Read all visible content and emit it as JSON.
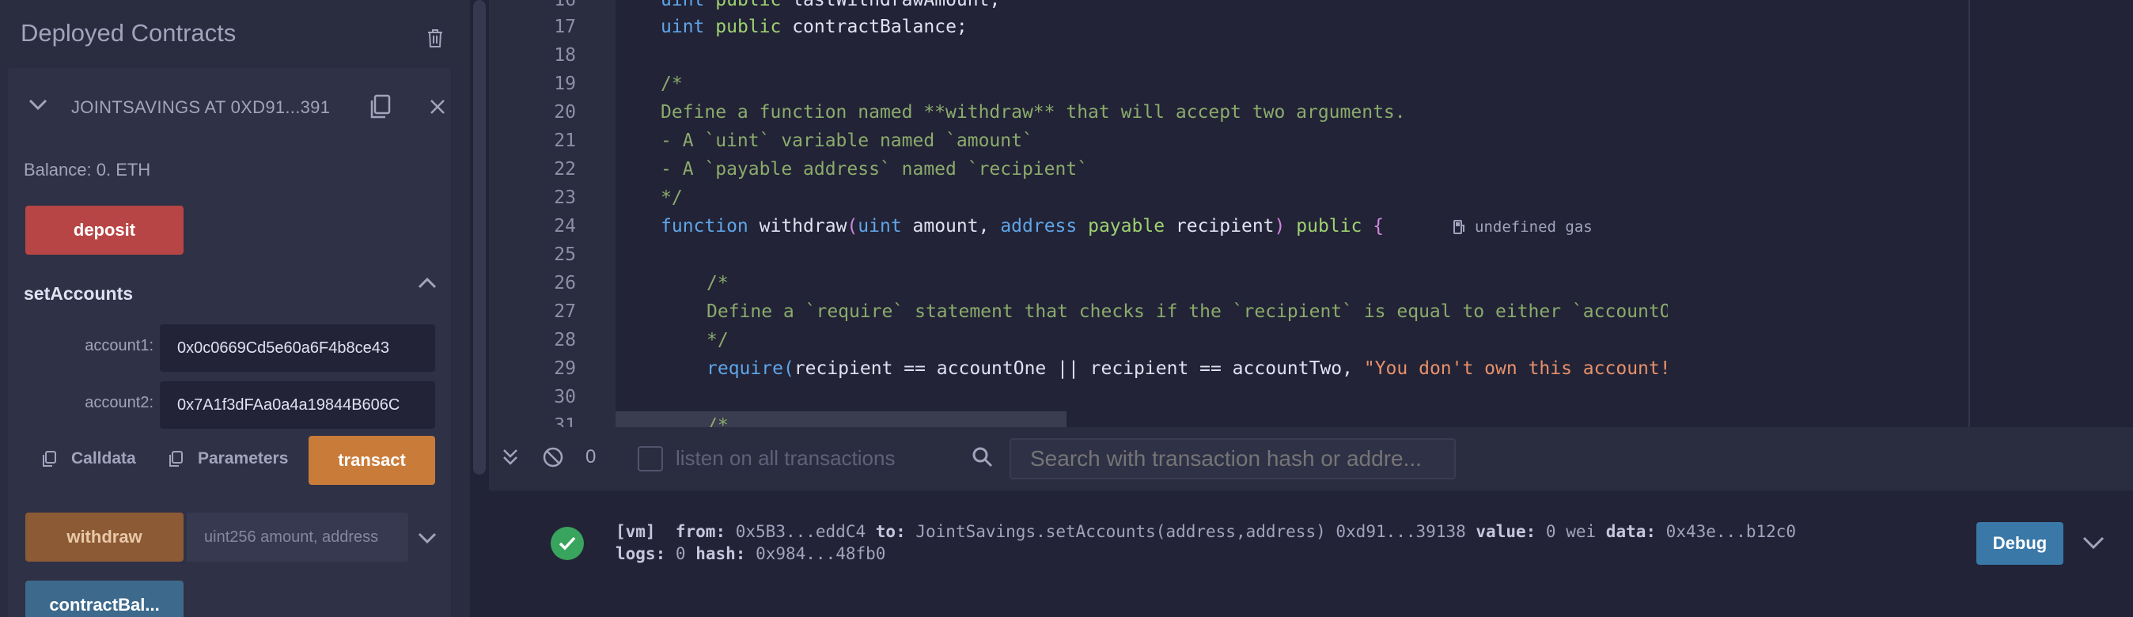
{
  "left_panel": {
    "title": "Deployed Contracts",
    "contract_name": "JOINTSAVINGS AT 0XD91...391",
    "balance": "Balance: 0. ETH",
    "deposit_label": "deposit",
    "set_accounts": {
      "title": "setAccounts",
      "account1_label": "account1:",
      "account1_value": "0x0c0669Cd5e60a6F4b8ce43",
      "account2_label": "account2:",
      "account2_value": "0x7A1f3dFAa0a4a19844B606C",
      "calldata_label": "Calldata",
      "parameters_label": "Parameters",
      "transact_label": "transact"
    },
    "withdraw_label": "withdraw",
    "withdraw_placeholder": "uint256 amount, address",
    "contract_balance_label": "contractBal..."
  },
  "editor": {
    "lines": [
      {
        "n": "16",
        "text": "uint public lastWithdrawAmount;"
      },
      {
        "n": "17",
        "text": "uint public contractBalance;"
      },
      {
        "n": "18",
        "text": ""
      },
      {
        "n": "19",
        "text": "/*"
      },
      {
        "n": "20",
        "text": "Define a function named **withdraw** that will accept two arguments."
      },
      {
        "n": "21",
        "text": "- A `uint` variable named `amount`"
      },
      {
        "n": "22",
        "text": "- A `payable address` named `recipient`"
      },
      {
        "n": "23",
        "text": "*/"
      },
      {
        "n": "24",
        "text": "function withdraw(uint amount, address payable recipient) public {"
      },
      {
        "n": "25",
        "text": ""
      },
      {
        "n": "26",
        "text": "/*"
      },
      {
        "n": "27",
        "text": "Define a `require` statement that checks if the `recipient` is equal to either `accountOne` or `accountTwo`. Th"
      },
      {
        "n": "28",
        "text": "*/"
      },
      {
        "n": "29",
        "text": "require(recipient == accountOne || recipient == accountTwo, \"You don't own this account!\");"
      },
      {
        "n": "30",
        "text": ""
      },
      {
        "n": "31",
        "text": "/*"
      }
    ],
    "gas_note": "undefined gas",
    "strings": {
      "l16a": "uint",
      "l16b": "public",
      "l16c": "lastWithdrawAmount;",
      "l17a": "uint",
      "l17b": "public",
      "l17c": "contractBalance;",
      "l24fn": "function",
      "l24name": "withdraw",
      "l24p1": "(",
      "l24uint": "uint",
      "l24amt": " amount,",
      "l24addr": "address",
      "l24pay": "payable",
      "l24rec": " recipient",
      "l24p2": ")",
      "l24pub": "public",
      "l24brace": "{",
      "l29req": "require",
      "l29p1": "(",
      "l29body": "recipient == accountOne || recipient == accountTwo, ",
      "l29str": "\"You don't own this account!\"",
      "l29p2": ")",
      "l29semi": ";"
    }
  },
  "terminal": {
    "count": "0",
    "listen_label": "listen on all transactions",
    "search_placeholder": "Search with transaction hash or addre...",
    "tx": {
      "vm": "[vm]",
      "from_label": "from:",
      "from": "0x5B3...eddC4",
      "to_label": "to:",
      "to": "JointSavings.setAccounts(address,address) 0xd91...39138",
      "value_label": "value:",
      "value": "0 wei",
      "data_label": "data:",
      "data": "0x43e...b12c0",
      "logs_label": "logs:",
      "logs": "0",
      "hash_label": "hash:",
      "hash": "0x984...48fb0"
    },
    "debug_label": "Debug"
  },
  "colors": {
    "deposit": "#b84545",
    "transact": "#c97c3a",
    "withdraw": "#8c5a34",
    "call": "#3d6a8c",
    "debug": "#3a78a8",
    "success": "#39a45e"
  }
}
